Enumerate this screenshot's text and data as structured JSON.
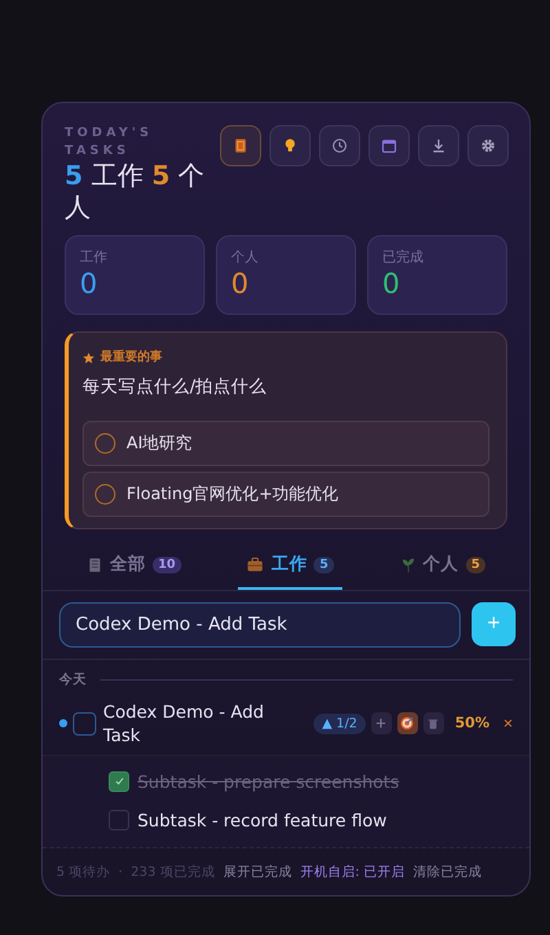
{
  "header": {
    "eyebrow": "TODAY'S TASKS",
    "work_count": "5",
    "work_label": "工作",
    "personal_count": "5",
    "personal_label": "个人"
  },
  "toolbar": [
    {
      "kind": "card",
      "selected": true
    },
    {
      "kind": "bulb",
      "selected": false
    },
    {
      "kind": "clock",
      "selected": false
    },
    {
      "kind": "calendar",
      "selected": false
    },
    {
      "kind": "download",
      "selected": false
    },
    {
      "kind": "settings",
      "selected": false
    }
  ],
  "stats": [
    {
      "label": "工作",
      "value": "0",
      "color": "#3a9ef0"
    },
    {
      "label": "个人",
      "value": "0",
      "color": "#e08a2e"
    },
    {
      "label": "已完成",
      "value": "0",
      "color": "#2fbf71"
    }
  ],
  "focus": {
    "heading": "最重要的事",
    "text": "每天写点什么/拍点什么",
    "items": [
      {
        "label": "AI地研究",
        "checked": false
      },
      {
        "label": "Floating官网优化+功能优化",
        "checked": false
      }
    ]
  },
  "tabs": [
    {
      "kind": "notebook",
      "label": "全部",
      "count": "10",
      "selected": false
    },
    {
      "kind": "briefcase",
      "label": "工作",
      "count": "5",
      "selected": true
    },
    {
      "kind": "leaf",
      "label": "个人",
      "count": "5",
      "selected": false
    }
  ],
  "input": {
    "value": "Codex Demo - Add Task",
    "button": "+"
  },
  "sections": [
    {
      "title": "今天",
      "tasks": [
        {
          "title": "Codex Demo - Add Task",
          "color": "#3a9ef0",
          "checked": false,
          "badge": "▲ 1/2",
          "progress": "50%",
          "remove": "×",
          "expanded": true,
          "subtasks": [
            {
              "title": "Subtask - prepare screenshots",
              "checked": true
            },
            {
              "title": "Subtask - record feature flow",
              "checked": false
            }
          ]
        }
      ]
    }
  ],
  "footer": {
    "pending": "5 项待办",
    "separator": "·",
    "done": "233 项已完成",
    "expand": "展开已完成",
    "autostart": "开机自启: 已开启",
    "clear": "清除已完成"
  }
}
